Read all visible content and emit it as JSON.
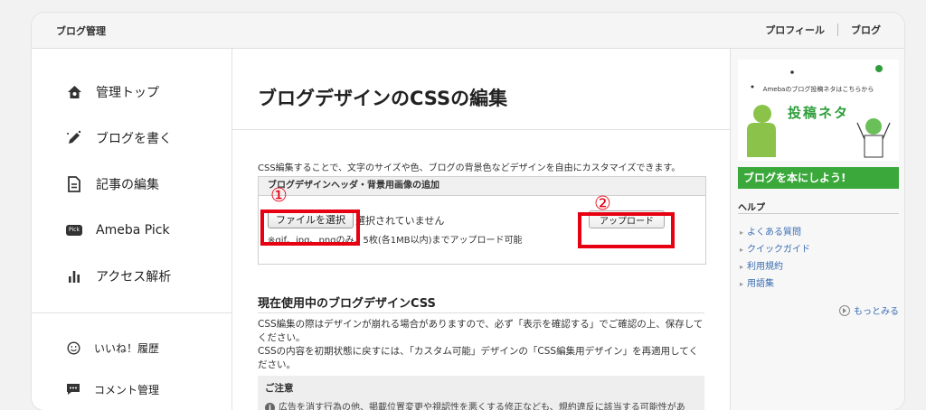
{
  "header": {
    "brand": "ブログ管理",
    "nav": [
      "プロフィール",
      "ブログ"
    ]
  },
  "sidebar": {
    "items": [
      {
        "label": "管理トップ",
        "icon": "home-icon"
      },
      {
        "label": "ブログを書く",
        "icon": "pen-icon"
      },
      {
        "label": "記事の編集",
        "icon": "document-icon"
      },
      {
        "label": "Ameba Pick",
        "icon": "pick-icon"
      },
      {
        "label": "アクセス解析",
        "icon": "bar-chart-icon"
      }
    ],
    "sub_items": [
      {
        "label": "いいね！履歴",
        "icon": "smile-icon"
      },
      {
        "label": "コメント管理",
        "icon": "comment-icon"
      }
    ],
    "pick_badge": "Pick"
  },
  "main": {
    "title": "ブログデザインのCSSの編集",
    "intro": "CSS編集することで、文字のサイズや色、ブログの背景色などデザインを自由にカスタマイズできます。",
    "upload": {
      "heading": "ブログデザインヘッダ・背景用画像の追加",
      "choose_label": "ファイルを選択",
      "no_file": "選択されていません",
      "note": "※gif、jpg、pngのみ、5枚(各1MB以内)までアップロード可能",
      "upload_label": "アップロード",
      "marker_1": "①",
      "marker_2": "②"
    },
    "section": {
      "title": "現在使用中のブログデザインCSS",
      "text1": "CSS編集の際はデザインが崩れる場合がありますので、必ず「表示を確認する」でご確認の上、保存してください。",
      "text2": "CSSの内容を初期状態に戻すには、「カスタム可能」デザインの「CSS編集用デザイン」を再適用してください。",
      "notice_title": "ご注意",
      "notice_text": "広告を消す行為の他、掲載位置変更や視認性を悪くする修正なども、規約違反に該当する可能性があ"
    }
  },
  "right": {
    "banner": {
      "top_text": "Amebaのブログ投稿ネタはこちらから",
      "main_text": "投稿ネタ"
    },
    "banner2": "ブログを本にしよう!",
    "help": {
      "title": "ヘルプ",
      "items": [
        "よくある質問",
        "クイックガイド",
        "利用規約",
        "用語集"
      ],
      "more": "もっとみる"
    }
  },
  "colors": {
    "accent_red": "#e60012",
    "link": "#3b6eb3",
    "banner_green": "#3aa83a"
  }
}
